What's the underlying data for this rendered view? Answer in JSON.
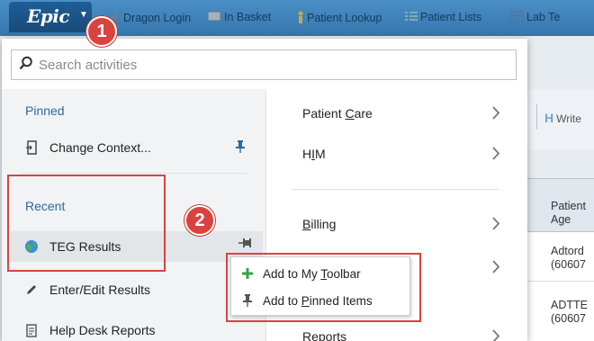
{
  "toolbar": {
    "logo": "Epic",
    "items": [
      {
        "label": "Dragon Login"
      },
      {
        "label": "In Basket"
      },
      {
        "label": "Patient Lookup"
      },
      {
        "label": "Patient Lists"
      },
      {
        "label": "Lab Te"
      }
    ]
  },
  "search": {
    "placeholder": "Search activities"
  },
  "pinned": {
    "title": "Pinned",
    "items": [
      {
        "label": "Change Context..."
      }
    ]
  },
  "recent": {
    "title": "Recent",
    "items": [
      {
        "label": "TEG Results"
      },
      {
        "label": "Enter/Edit Results"
      },
      {
        "label": "Help Desk Reports"
      }
    ]
  },
  "categories": [
    {
      "pre": "Patient ",
      "key": "C",
      "post": "are"
    },
    {
      "pre": "H",
      "key": "I",
      "post": "M"
    },
    {
      "pre": "",
      "key": "B",
      "post": "illing"
    },
    {
      "pre": "Reports",
      "key": "",
      "post": ""
    }
  ],
  "context_menu": {
    "items": [
      {
        "pre": "Add to My ",
        "key": "T",
        "post": "oolbar"
      },
      {
        "pre": "Add to ",
        "key": "P",
        "post": "inned Items"
      }
    ]
  },
  "background": {
    "write_label": "Write",
    "column_header": [
      "Patient",
      "Age"
    ],
    "rows": [
      [
        "Adtord",
        "(60607"
      ],
      [
        "ADTTE",
        "(60607"
      ]
    ]
  },
  "annotations": {
    "step1": "1",
    "step2": "2"
  },
  "colors": {
    "accent": "#2b6aa3",
    "annotation": "#d9433f",
    "toolbar": "#3f83bb"
  }
}
